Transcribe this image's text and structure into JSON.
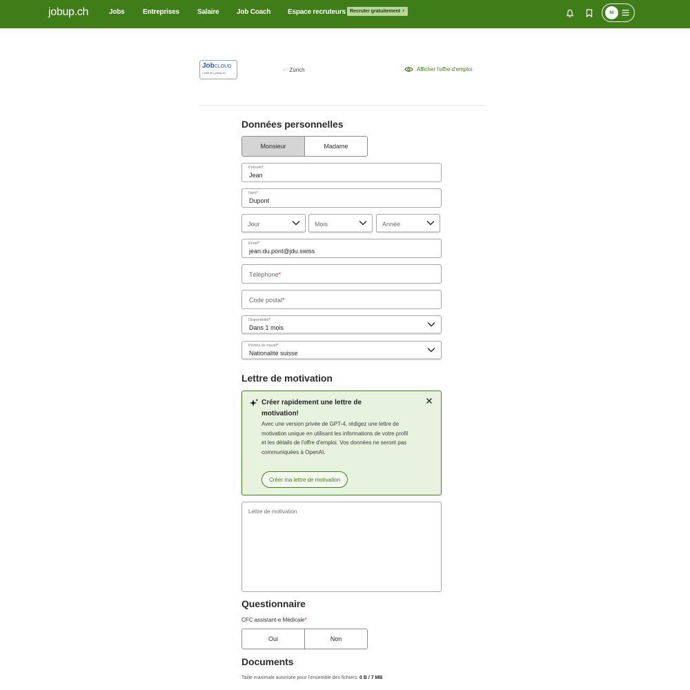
{
  "colors": {
    "brand": "#3f7d18",
    "required": "#d0242b",
    "ai_bg": "#e8f3df"
  },
  "nav": {
    "logo": "jobup.ch",
    "links": [
      "Jobs",
      "Entreprises",
      "Salaire",
      "Job Coach",
      "Espace recruteurs"
    ],
    "badge": "Recruter gratuitement",
    "avatar_initials": "NI",
    "icons": [
      "bell-icon",
      "bookmark-icon",
      "hamburger-icon"
    ]
  },
  "employer": {
    "logo_main": "Job",
    "logo_suffix": "CLOUD",
    "logo_sub": "• jobs.ch | jobup.ch",
    "location": "Zürich",
    "show_offer": "Afficher l'offre d'emploi"
  },
  "personal": {
    "title": "Données personnelles",
    "salutation": {
      "options": [
        "Monsieur",
        "Madame"
      ],
      "selected": "Monsieur"
    },
    "first_name": {
      "label": "Prénom",
      "value": "Jean"
    },
    "last_name": {
      "label": "Nom",
      "value": "Dupont"
    },
    "birth": {
      "day": "Jour",
      "month": "Mois",
      "year": "Année"
    },
    "email": {
      "label": "Email",
      "value": "jean.du.pont@jdu.swiss"
    },
    "phone": {
      "placeholder": "Téléphone"
    },
    "postal": {
      "placeholder": "Code postal"
    },
    "availability": {
      "label": "Disponibilité",
      "value": "Dans 1 mois"
    },
    "permit": {
      "label": "Permis de travail",
      "value": "Nationalité suisse"
    },
    "required_mark": "*"
  },
  "motivation": {
    "title": "Lettre de motivation",
    "ai": {
      "title": "Créer rapidement une lettre de motivation!",
      "text": "Avec une version privée de GPT-4, rédigez une lettre de motivation unique en utilisant les informations de votre profil et les détails de l'offre d'emploi. Vos données ne seront pas communiquées à OpenAI.",
      "cta": "Créer ma lettre de motivation"
    },
    "textarea_placeholder": "Lettre de motivation"
  },
  "questionnaire": {
    "title": "Questionnaire",
    "question": "CFC assistant-e Médicale",
    "options": [
      "Oui",
      "Non"
    ]
  },
  "documents": {
    "title": "Documents",
    "size_note": "Taille maximale autorisée pour l'ensemble des fichiers:",
    "size_value": "0 B / 7 MB"
  }
}
